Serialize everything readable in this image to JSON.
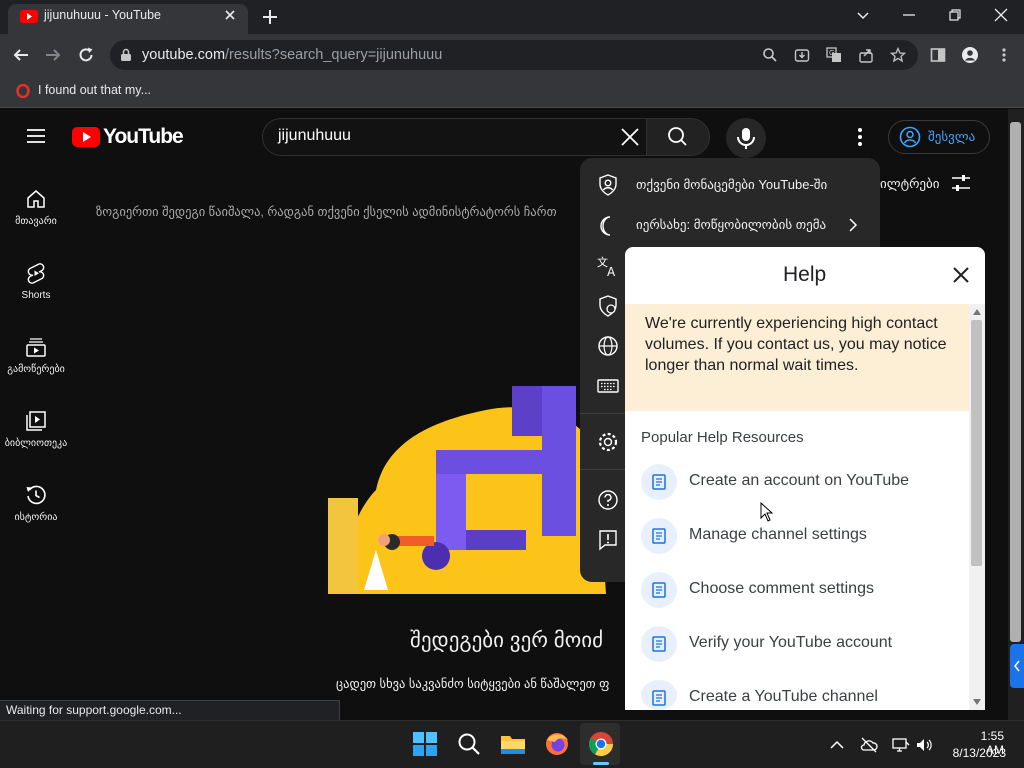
{
  "browser": {
    "tab_title": "jijunuhuuu - YouTube",
    "url_host": "youtube.com",
    "url_path": "/results?search_query=jijunuhuuu",
    "bookmark_label": "I found out that my...",
    "status_text": "Waiting for support.google.com..."
  },
  "youtube": {
    "logo_text": "YouTube",
    "search_value": "jijunuhuuu",
    "signin_label": "შესვლა",
    "sidebar": [
      {
        "label": "მთავარი",
        "icon": "home-icon"
      },
      {
        "label": "Shorts",
        "icon": "shorts-icon"
      },
      {
        "label": "გამოწერები",
        "icon": "subscriptions-icon"
      },
      {
        "label": "ბიბლიოთეკა",
        "icon": "library-icon"
      },
      {
        "label": "ისტორია",
        "icon": "history-icon"
      }
    ],
    "notice": "ზოგიერთი შედეგი წაიშალა, რადგან თქვენი ქსელის ადმინისტრატორს ჩართ",
    "filters_label": "ილტრები",
    "no_results_title": "შედეგები ვერ მოიძ",
    "no_results_sub": "ცადეთ სხვა საკვანძო სიტყვები ან წაშალეთ ფ"
  },
  "settings_menu": {
    "items": [
      {
        "label": "თქვენი მონაცემები YouTube-ში",
        "icon": "user-shield-icon"
      },
      {
        "label": "იერსახე: მოწყობილობის თემა",
        "icon": "moon-icon"
      },
      {
        "label": "",
        "icon": "translate-icon"
      },
      {
        "label": "",
        "icon": "restricted-icon"
      },
      {
        "label": "",
        "icon": "globe-icon"
      },
      {
        "label": "",
        "icon": "keyboard-icon"
      },
      {
        "label": "",
        "icon": "gear-icon"
      },
      {
        "label": "",
        "icon": "help-icon"
      },
      {
        "label": "",
        "icon": "feedback-icon"
      }
    ]
  },
  "help": {
    "title": "Help",
    "banner": "We're currently experiencing high contact volumes. If you contact us, you may notice longer than normal wait times.",
    "section_title": "Popular Help Resources",
    "articles": [
      "Create an account on YouTube",
      "Manage channel settings",
      "Choose comment settings",
      "Verify your YouTube account",
      "Create a YouTube channel"
    ]
  },
  "taskbar": {
    "time": "1:55 AM",
    "date": "8/13/2023"
  },
  "colors": {
    "youtube_red": "#ff0000",
    "link_blue": "#3ea6ff",
    "banner_bg": "#fdefd6"
  }
}
